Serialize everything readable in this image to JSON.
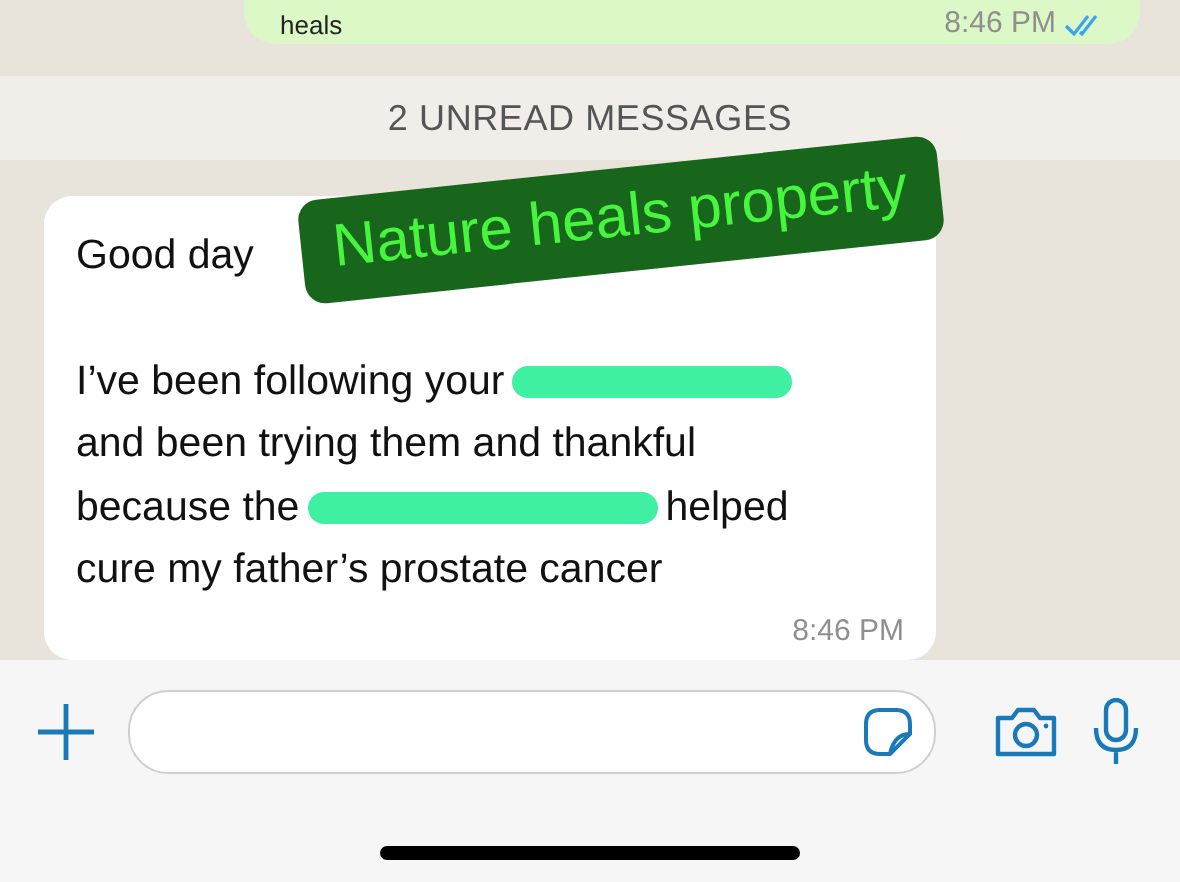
{
  "sent_message": {
    "text": "heals",
    "time": "8:46 PM",
    "read": true
  },
  "unread_banner": "2 UNREAD MESSAGES",
  "received_message": {
    "paragraphs": [
      [
        [
          {
            "kind": "text",
            "text": "Good day"
          }
        ]
      ],
      [
        [
          {
            "kind": "text",
            "text": "I’ve been following your"
          },
          {
            "kind": "redaction"
          }
        ],
        [
          {
            "kind": "text",
            "text": "and been trying them and thankful"
          }
        ],
        [
          {
            "kind": "text",
            "text": "because the"
          },
          {
            "kind": "redaction"
          },
          {
            "kind": "text",
            "text": "helped"
          }
        ],
        [
          {
            "kind": "text",
            "text": "cure my father’s prostate cancer"
          }
        ]
      ]
    ],
    "time": "8:46 PM"
  },
  "overlay_label": "Nature heals property"
}
